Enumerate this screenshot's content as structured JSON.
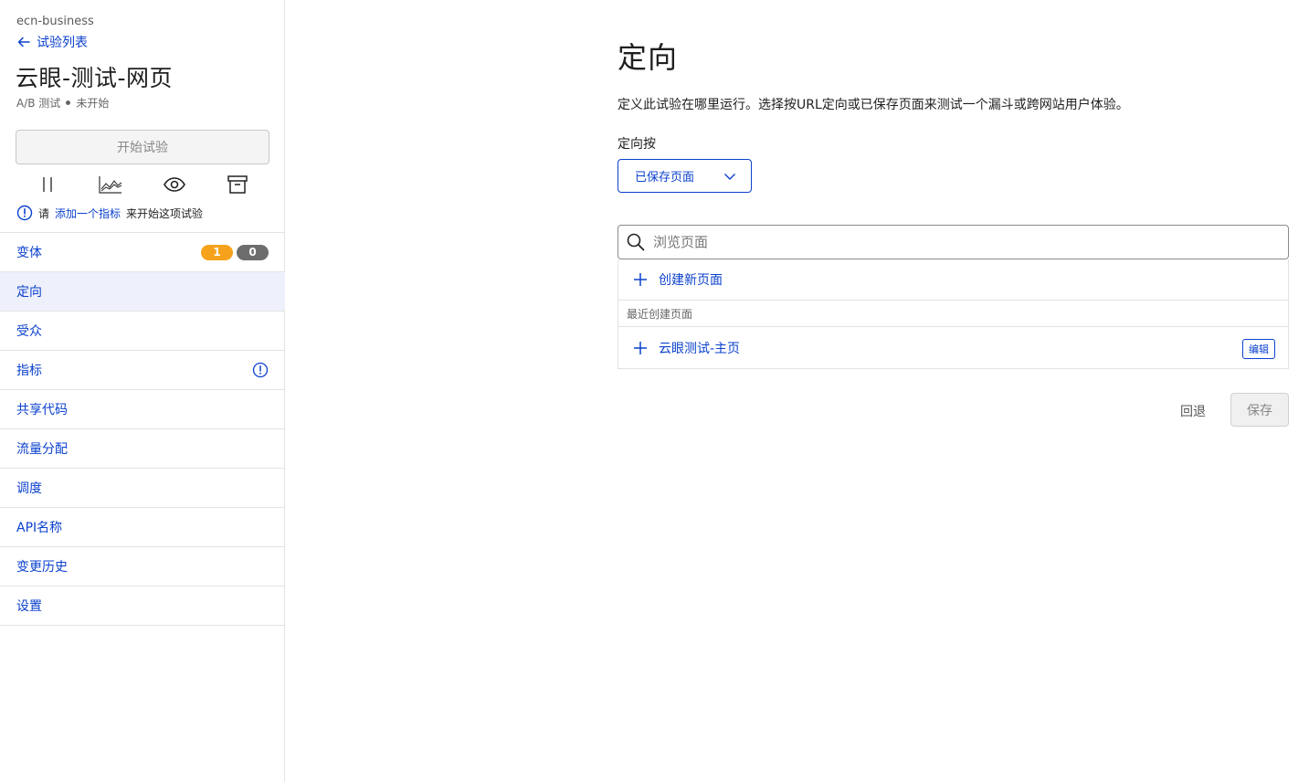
{
  "sidebar": {
    "org": "ecn-business",
    "back_label": "试验列表",
    "experiment_title": "云眼-测试-网页",
    "experiment_type": "A/B 测试",
    "experiment_status": "未开始",
    "start_button": "开始试验",
    "toolbar_icons": [
      "pause-icon",
      "chart-icon",
      "eye-icon",
      "archive-icon"
    ],
    "notice": {
      "prefix": "请",
      "link": "添加一个指标",
      "suffix": "来开始这项试验"
    },
    "nav": [
      {
        "label": "变体",
        "badges": [
          "1",
          "0"
        ]
      },
      {
        "label": "定向",
        "active": true
      },
      {
        "label": "受众"
      },
      {
        "label": "指标",
        "warning": true
      },
      {
        "label": "共享代码"
      },
      {
        "label": "流量分配"
      },
      {
        "label": "调度"
      },
      {
        "label": "API名称"
      },
      {
        "label": "变更历史"
      },
      {
        "label": "设置"
      }
    ]
  },
  "main": {
    "title": "定向",
    "description": "定义此试验在哪里运行。选择按URL定向或已保存页面来测试一个漏斗或跨网站用户体验。",
    "target_by_label": "定向按",
    "target_by_value": "已保存页面",
    "search_placeholder": "浏览页面",
    "create_new_label": "创建新页面",
    "recent_heading": "最近创建页面",
    "recent_pages": [
      {
        "name": "云眼测试-主页",
        "edit_label": "编辑"
      }
    ],
    "revert_label": "回退",
    "save_label": "保存"
  },
  "colors": {
    "link_blue": "#0b41cd",
    "badge_orange": "#f6a21c",
    "badge_gray": "#6d6d6d",
    "active_nav_bg": "#eef1fb"
  }
}
